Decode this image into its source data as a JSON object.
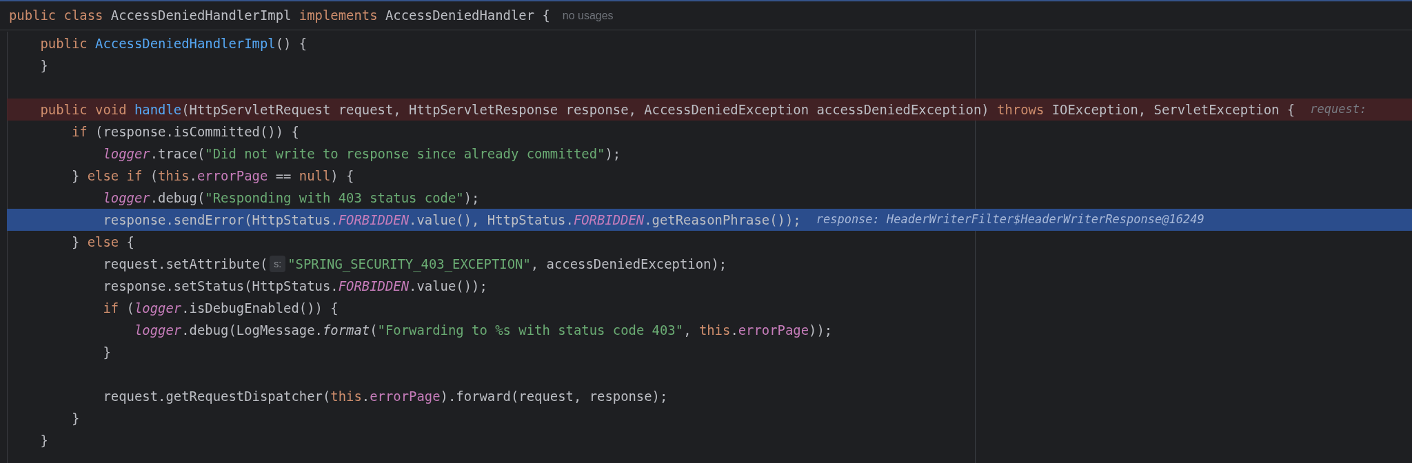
{
  "sticky_header": {
    "tokens": [
      {
        "text": "public class ",
        "kind": "keyword"
      },
      {
        "text": "AccessDeniedHandlerImpl ",
        "kind": "plain"
      },
      {
        "text": "implements ",
        "kind": "keyword"
      },
      {
        "text": "AccessDeniedHandler {",
        "kind": "plain"
      }
    ],
    "usage_hint": "no usages"
  },
  "lines": [
    {
      "breakpoint": false,
      "current": false,
      "parts": [
        {
          "kind": "code",
          "tokens": [
            {
              "text": "    public ",
              "kind": "keyword"
            },
            {
              "text": "AccessDeniedHandlerImpl",
              "kind": "declaration"
            },
            {
              "text": "() {",
              "kind": "plain"
            }
          ]
        }
      ]
    },
    {
      "breakpoint": false,
      "current": false,
      "parts": [
        {
          "kind": "code",
          "tokens": [
            {
              "text": "    }",
              "kind": "plain"
            }
          ]
        }
      ]
    },
    {
      "breakpoint": false,
      "current": false
    },
    {
      "breakpoint": true,
      "current": false,
      "parts": [
        {
          "kind": "code",
          "tokens": [
            {
              "text": "    public void ",
              "kind": "keyword"
            },
            {
              "text": "handle",
              "kind": "declaration"
            },
            {
              "text": "(HttpServletRequest request, HttpServletResponse response, AccessDeniedException accessDeniedException) ",
              "kind": "plain"
            },
            {
              "text": "throws ",
              "kind": "keyword"
            },
            {
              "text": "IOException, ServletException {",
              "kind": "plain"
            }
          ]
        },
        {
          "kind": "inline_value",
          "text": "request:"
        }
      ]
    },
    {
      "breakpoint": false,
      "current": false,
      "parts": [
        {
          "kind": "code",
          "tokens": [
            {
              "text": "        if ",
              "kind": "keyword"
            },
            {
              "text": "(response.isCommitted()) {",
              "kind": "plain"
            }
          ]
        }
      ]
    },
    {
      "breakpoint": false,
      "current": false,
      "parts": [
        {
          "kind": "code",
          "tokens": [
            {
              "text": "            logger",
              "kind": "static_field"
            },
            {
              "text": ".trace(",
              "kind": "plain"
            },
            {
              "text": "\"Did not write to response since already committed\"",
              "kind": "string"
            },
            {
              "text": ");",
              "kind": "plain"
            }
          ]
        }
      ]
    },
    {
      "breakpoint": false,
      "current": false,
      "parts": [
        {
          "kind": "code",
          "tokens": [
            {
              "text": "        } ",
              "kind": "plain"
            },
            {
              "text": "else if ",
              "kind": "keyword"
            },
            {
              "text": "(",
              "kind": "plain"
            },
            {
              "text": "this",
              "kind": "keyword"
            },
            {
              "text": ".",
              "kind": "plain"
            },
            {
              "text": "errorPage",
              "kind": "field"
            },
            {
              "text": " == ",
              "kind": "plain"
            },
            {
              "text": "null",
              "kind": "keyword"
            },
            {
              "text": ") {",
              "kind": "plain"
            }
          ]
        }
      ]
    },
    {
      "breakpoint": false,
      "current": false,
      "parts": [
        {
          "kind": "code",
          "tokens": [
            {
              "text": "            logger",
              "kind": "static_field"
            },
            {
              "text": ".debug(",
              "kind": "plain"
            },
            {
              "text": "\"Responding with 403 status code\"",
              "kind": "string"
            },
            {
              "text": ");",
              "kind": "plain"
            }
          ]
        }
      ]
    },
    {
      "breakpoint": false,
      "current": true,
      "parts": [
        {
          "kind": "code",
          "tokens": [
            {
              "text": "            response.sendError(HttpStatus.",
              "kind": "plain"
            },
            {
              "text": "FORBIDDEN",
              "kind": "static_field"
            },
            {
              "text": ".value(), HttpStatus.",
              "kind": "plain"
            },
            {
              "text": "FORBIDDEN",
              "kind": "static_field"
            },
            {
              "text": ".getReasonPhrase());",
              "kind": "plain"
            }
          ]
        },
        {
          "kind": "inline_value",
          "text": "response: HeaderWriterFilter$HeaderWriterResponse@16249"
        }
      ]
    },
    {
      "breakpoint": false,
      "current": false,
      "parts": [
        {
          "kind": "code",
          "tokens": [
            {
              "text": "        } ",
              "kind": "plain"
            },
            {
              "text": "else ",
              "kind": "keyword"
            },
            {
              "text": "{",
              "kind": "plain"
            }
          ]
        }
      ]
    },
    {
      "breakpoint": false,
      "current": false,
      "parts": [
        {
          "kind": "code",
          "tokens": [
            {
              "text": "            request.setAttribute(",
              "kind": "plain"
            }
          ]
        },
        {
          "kind": "param_hint",
          "text": "s:"
        },
        {
          "kind": "code",
          "tokens": [
            {
              "text": "\"SPRING_SECURITY_403_EXCEPTION\"",
              "kind": "string"
            },
            {
              "text": ", accessDeniedException);",
              "kind": "plain"
            }
          ]
        }
      ]
    },
    {
      "breakpoint": false,
      "current": false,
      "parts": [
        {
          "kind": "code",
          "tokens": [
            {
              "text": "            response.setStatus(HttpStatus.",
              "kind": "plain"
            },
            {
              "text": "FORBIDDEN",
              "kind": "static_field"
            },
            {
              "text": ".value());",
              "kind": "plain"
            }
          ]
        }
      ]
    },
    {
      "breakpoint": false,
      "current": false,
      "parts": [
        {
          "kind": "code",
          "tokens": [
            {
              "text": "            if ",
              "kind": "keyword"
            },
            {
              "text": "(",
              "kind": "plain"
            },
            {
              "text": "logger",
              "kind": "static_field"
            },
            {
              "text": ".isDebugEnabled()) {",
              "kind": "plain"
            }
          ]
        }
      ]
    },
    {
      "breakpoint": false,
      "current": false,
      "parts": [
        {
          "kind": "code",
          "tokens": [
            {
              "text": "                logger",
              "kind": "static_field"
            },
            {
              "text": ".debug(LogMessage.",
              "kind": "plain"
            },
            {
              "text": "format",
              "kind": "static_method"
            },
            {
              "text": "(",
              "kind": "plain"
            },
            {
              "text": "\"Forwarding to %s with status code 403\"",
              "kind": "string"
            },
            {
              "text": ", ",
              "kind": "plain"
            },
            {
              "text": "this",
              "kind": "keyword"
            },
            {
              "text": ".",
              "kind": "plain"
            },
            {
              "text": "errorPage",
              "kind": "field"
            },
            {
              "text": "));",
              "kind": "plain"
            }
          ]
        }
      ]
    },
    {
      "breakpoint": false,
      "current": false,
      "parts": [
        {
          "kind": "code",
          "tokens": [
            {
              "text": "            }",
              "kind": "plain"
            }
          ]
        }
      ]
    },
    {
      "breakpoint": false,
      "current": false
    },
    {
      "breakpoint": false,
      "current": false,
      "parts": [
        {
          "kind": "code",
          "tokens": [
            {
              "text": "            request.getRequestDispatcher(",
              "kind": "plain"
            },
            {
              "text": "this",
              "kind": "keyword"
            },
            {
              "text": ".",
              "kind": "plain"
            },
            {
              "text": "errorPage",
              "kind": "field"
            },
            {
              "text": ").forward(request, response);",
              "kind": "plain"
            }
          ]
        }
      ]
    },
    {
      "breakpoint": false,
      "current": false,
      "parts": [
        {
          "kind": "code",
          "tokens": [
            {
              "text": "        }",
              "kind": "plain"
            }
          ]
        }
      ]
    },
    {
      "breakpoint": false,
      "current": false,
      "parts": [
        {
          "kind": "code",
          "tokens": [
            {
              "text": "    }",
              "kind": "plain"
            }
          ]
        }
      ]
    }
  ]
}
